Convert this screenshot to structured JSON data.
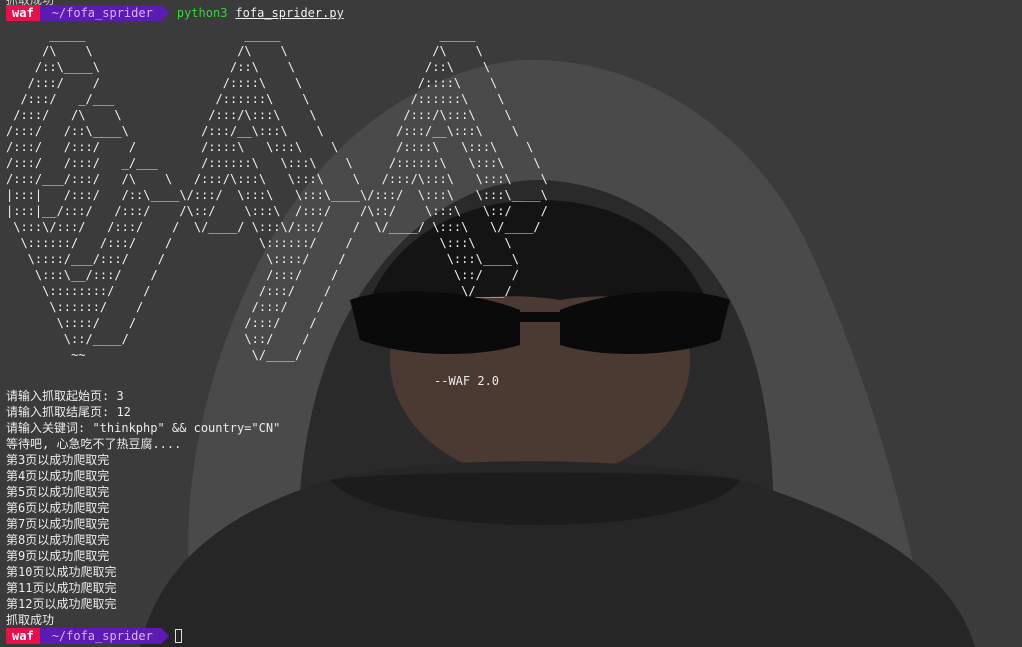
{
  "prompt_top": {
    "user": "waf",
    "dir": "~/fofa_sprider",
    "command": "python3",
    "argument": "fofa_sprider.py"
  },
  "partial_top_text": "抓取成功",
  "ascii_art": "      _____                      _____                      _____\n     /\\    \\                    /\\    \\                    /\\    \\\n    /::\\____\\                  /::\\    \\                  /::\\    \\\n   /:::/    /                 /::::\\    \\                /::::\\    \\\n  /:::/   _/___              /::::::\\    \\              /::::::\\    \\\n /:::/   /\\    \\            /:::/\\:::\\    \\            /:::/\\:::\\    \\\n/:::/   /::\\____\\          /:::/__\\:::\\    \\          /:::/__\\:::\\    \\\n\n\n\n\n\n\n\n\n\n\n\n\n\n",
  "ascii_rows": [
    "      _____                      _____                      _____",
    "     /\\    \\                    /\\    \\                    /\\    \\",
    "    /::\\____\\                  /::\\    \\                  /::\\    \\",
    "   /:::/    /                 /::::\\    \\                /::::\\    \\",
    "  /:::/   _/___              /::::::\\    \\              /::::::\\    \\",
    " /:::/   /\\    \\            /:::/\\:::\\    \\            /:::/\\:::\\    \\",
    "/:::/   /::\\____\\          /:::/__\\:::\\    \\          /:::/__\\:::\\    \\",
    "/:::/   /:::/    /         /::::\\   \\:::\\    \\        /::::\\   \\:::\\    \\",
    "/:::/   /:::/   _/___      /::::::\\   \\:::\\    \\     /::::::\\   \\:::\\    \\",
    "/:::/___/:::/   /\\    \\   /:::/\\:::\\   \\:::\\    \\   /:::/\\:::\\   \\:::\\    \\",
    "|:::|   /:::/   /::\\____\\/:::/  \\:::\\   \\:::\\____\\/:::/  \\:::\\   \\:::\\____\\",
    "|:::|__/:::/   /:::/    /\\::/    \\:::\\  /:::/    /\\::/    \\:::\\   \\::/    /",
    " \\:::\\/:::/   /:::/    /  \\/____/ \\:::\\/:::/    /  \\/____/ \\:::\\   \\/____/",
    "  \\::::::/   /:::/    /            \\::::::/    /            \\:::\\    \\",
    "   \\::::/___/:::/    /              \\::::/    /              \\:::\\____\\",
    "    \\:::\\__/:::/    /               /:::/    /                \\::/    /",
    "     \\::::::::/    /               /:::/    /                  \\/____/",
    "      \\::::::/    /               /:::/    /",
    "       \\::::/    /               /:::/    /",
    "        \\::/____/                \\::/    /",
    "         ~~                       \\/____/"
  ],
  "version": "--WAF 2.0",
  "output_lines": [
    "请输入抓取起始页: 3",
    "请输入抓取结尾页: 12",
    "请输入关键词: \"thinkphp\" && country=\"CN\"",
    "等待吧, 心急吃不了热豆腐....",
    "第3页以成功爬取完",
    "第4页以成功爬取完",
    "第5页以成功爬取完",
    "第6页以成功爬取完",
    "第7页以成功爬取完",
    "第8页以成功爬取完",
    "第9页以成功爬取完",
    "第10页以成功爬取完",
    "第11页以成功爬取完",
    "第12页以成功爬取完",
    "抓取成功"
  ],
  "prompt_bottom": {
    "user": "waf",
    "dir": "~/fofa_sprider"
  },
  "colors": {
    "user_segment": "#e8104a",
    "dir_segment": "#5d1bb5",
    "command": "#3fd13f"
  }
}
